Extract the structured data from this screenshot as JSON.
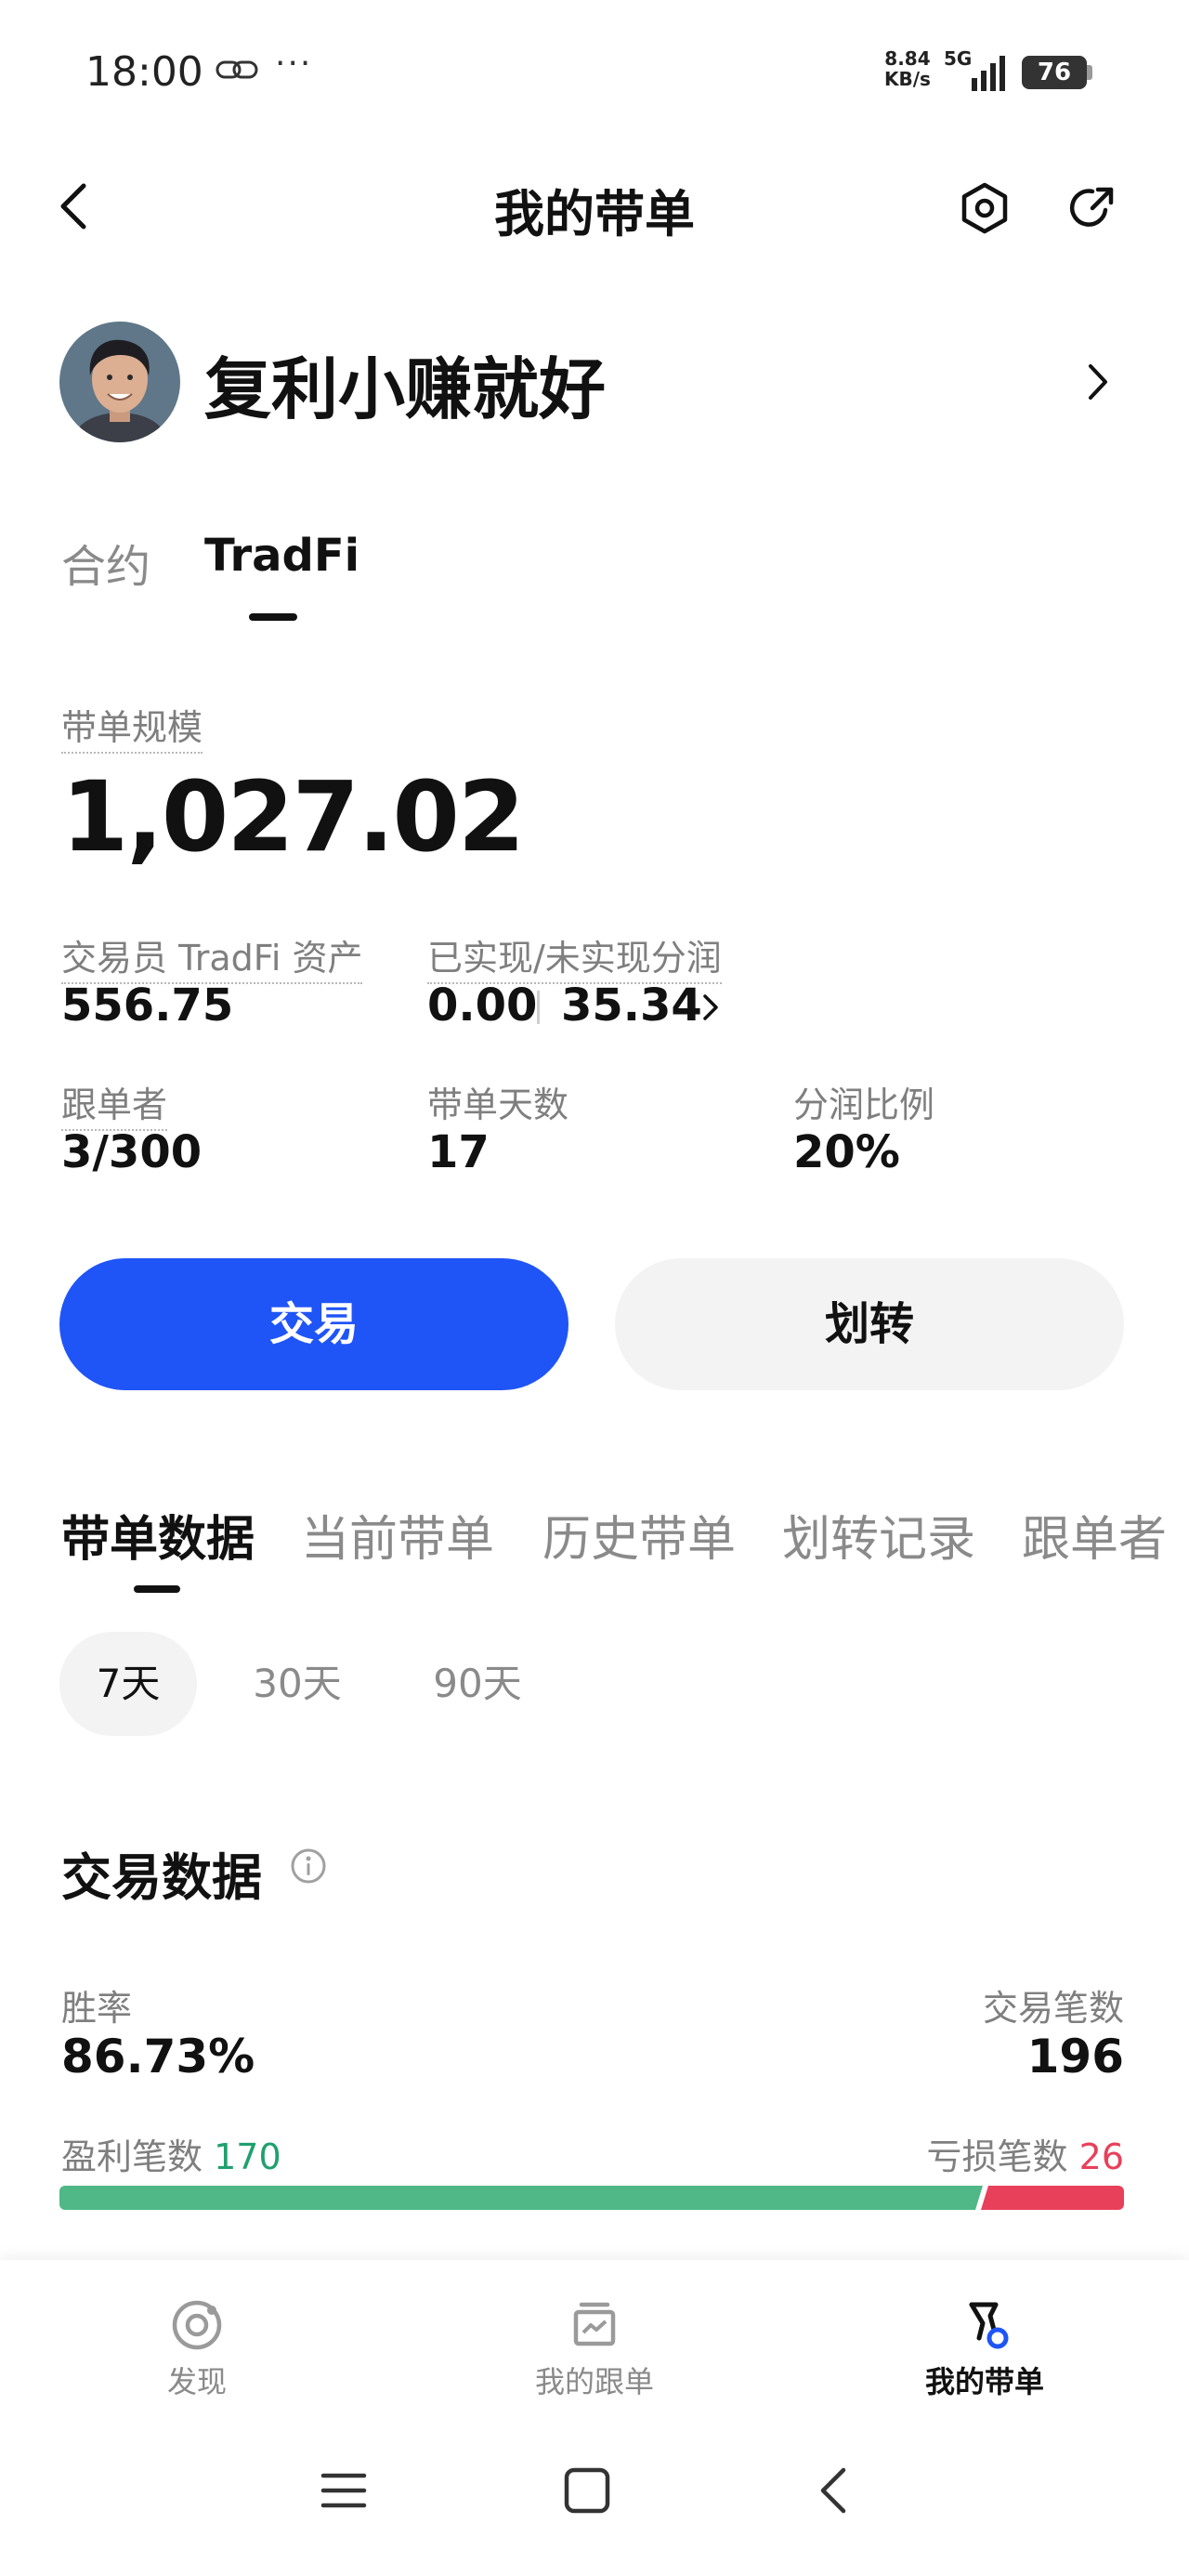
{
  "status_bar": {
    "time": "18:00",
    "dots": "···",
    "net_speed": "8.84",
    "net_unit": "KB/s",
    "net_type": "5G",
    "battery": "76"
  },
  "header": {
    "title": "我的带单"
  },
  "profile": {
    "name": "复利小赚就好"
  },
  "product_tabs": [
    "合约",
    "TradFi"
  ],
  "scale": {
    "label": "带单规模",
    "value": "1,027.02"
  },
  "stats": {
    "trader_assets_label": "交易员 TradFi 资产",
    "trader_assets_value": "556.75",
    "profit_share_label": "已实现/未实现分润",
    "realized": "0.00",
    "unrealized": "35.34",
    "followers_label": "跟单者",
    "followers_value": "3/300",
    "days_label": "带单天数",
    "days_value": "17",
    "ratio_label": "分润比例",
    "ratio_value": "20%"
  },
  "buttons": {
    "trade": "交易",
    "transfer": "划转"
  },
  "section_tabs": [
    "带单数据",
    "当前带单",
    "历史带单",
    "划转记录",
    "跟单者"
  ],
  "ranges": [
    "7天",
    "30天",
    "90天"
  ],
  "trade_data": {
    "title": "交易数据",
    "win_rate_label": "胜率",
    "win_rate_value": "86.73%",
    "trade_count_label": "交易笔数",
    "trade_count_value": "196",
    "profit_label": "盈利笔数",
    "profit_count": "170",
    "loss_label": "亏损笔数",
    "loss_count": "26",
    "profit_ratio": 0.867
  },
  "bottom_nav": [
    "发现",
    "我的跟单",
    "我的带单"
  ],
  "colors": {
    "primary": "#1f55f6",
    "profit": "#1fa06e",
    "profit_bar": "#4fb886",
    "loss": "#e8405a"
  }
}
